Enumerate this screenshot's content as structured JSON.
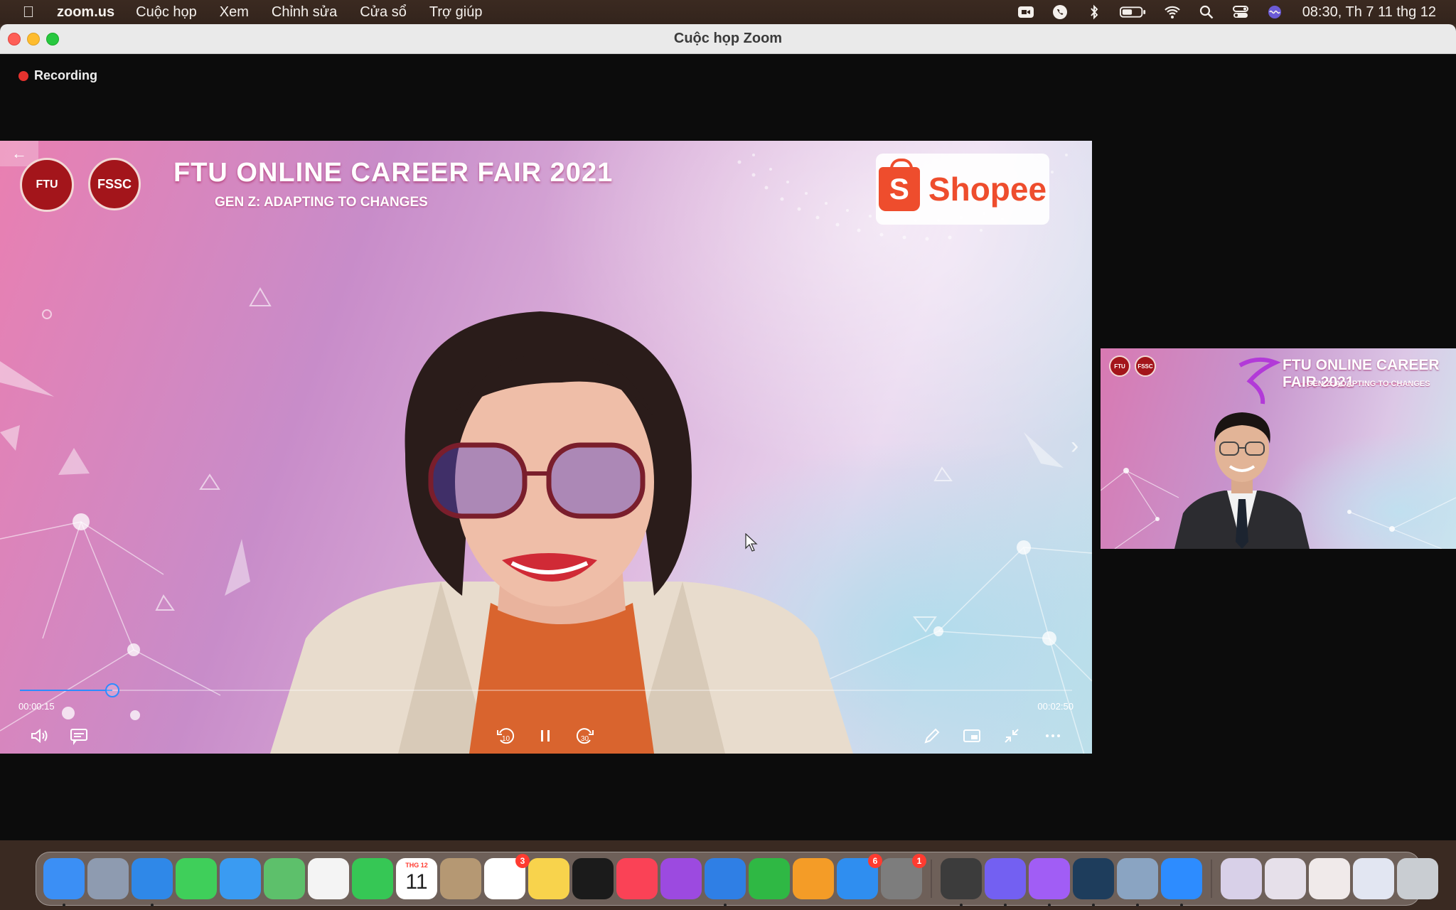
{
  "menubar": {
    "app_name": "zoom.us",
    "menus": [
      "Cuộc họp",
      "Xem",
      "Chỉnh sửa",
      "Cửa sổ",
      "Trợ giúp"
    ],
    "tray_icons": [
      "zoom-tray-icon",
      "viber-tray-icon",
      "bluetooth-icon",
      "battery-icon",
      "wifi-icon",
      "spotlight-search-icon",
      "control-center-icon",
      "siri-icon"
    ],
    "clock": "08:30, Th 7 11 thg 12"
  },
  "window": {
    "title": "Cuộc họp Zoom",
    "recording_label": "Recording"
  },
  "share": {
    "logo_left": "FTU",
    "logo_right": "FSSC",
    "title": "FTU ONLINE CAREER FAIR 2021",
    "subtitle": "GEN Z: ADAPTING TO CHANGES",
    "sponsor_letter": "S",
    "sponsor": "Shopee",
    "player": {
      "time_current": "00:00:15",
      "time_total": "00:02:50",
      "progress_fraction": 0.088,
      "rewind_seconds": "10",
      "forward_seconds": "30"
    }
  },
  "thumbnail": {
    "title": "FTU ONLINE CAREER FAIR 2021",
    "subtitle": "GEN Z: ADAPTING TO CHANGES"
  },
  "dock": {
    "calendar_month": "THG 12",
    "calendar_day": "11",
    "apps": [
      {
        "name": "finder",
        "color": "#3b8ff5",
        "running": true
      },
      {
        "name": "launchpad",
        "color": "#8e9bb0",
        "running": false
      },
      {
        "name": "safari",
        "color": "#2f88e8",
        "running": true
      },
      {
        "name": "messages",
        "color": "#3fcf5a",
        "running": false
      },
      {
        "name": "mail",
        "color": "#3a9bf2",
        "running": false
      },
      {
        "name": "maps",
        "color": "#5dc06b",
        "running": false
      },
      {
        "name": "photos",
        "color": "#f4f4f4",
        "running": false
      },
      {
        "name": "facetime",
        "color": "#36c755",
        "running": false
      },
      {
        "name": "calendar",
        "color": "#ffffff",
        "running": false
      },
      {
        "name": "contacts",
        "color": "#b59873",
        "running": false
      },
      {
        "name": "reminders",
        "color": "#ffffff",
        "running": false,
        "badge": "3"
      },
      {
        "name": "notes",
        "color": "#f8d34c",
        "running": false
      },
      {
        "name": "apple-tv",
        "color": "#1b1b1b",
        "running": false
      },
      {
        "name": "music",
        "color": "#fa4256",
        "running": false
      },
      {
        "name": "podcasts",
        "color": "#9c4ae0",
        "running": false
      },
      {
        "name": "keynote",
        "color": "#2f7fe5",
        "running": true
      },
      {
        "name": "numbers",
        "color": "#2fb844",
        "running": false
      },
      {
        "name": "pages",
        "color": "#f49c27",
        "running": false
      },
      {
        "name": "app-store",
        "color": "#2f8ef0",
        "running": false,
        "badge": "6"
      },
      {
        "name": "system-preferences",
        "color": "#7d7d7d",
        "running": false,
        "badge": "1"
      }
    ],
    "apps_right": [
      {
        "name": "screen-recorder",
        "color": "#3c3c3c",
        "running": true
      },
      {
        "name": "viber",
        "color": "#7360f2",
        "running": true
      },
      {
        "name": "messenger",
        "color": "#a15df5",
        "running": true
      },
      {
        "name": "quicktime",
        "color": "#1e3d5c",
        "running": true
      },
      {
        "name": "preview",
        "color": "#8aa4c2",
        "running": true
      },
      {
        "name": "zoom",
        "color": "#2d8cff",
        "running": true
      }
    ],
    "stack": [
      {
        "name": "downloads-stack-1",
        "color": "#d8d0e8"
      },
      {
        "name": "downloads-stack-2",
        "color": "#e6e0ea"
      },
      {
        "name": "downloads-stack-3",
        "color": "#f0eaea"
      },
      {
        "name": "downloads-stack-4",
        "color": "#e2e6f2"
      },
      {
        "name": "trash",
        "color": "#c9cdd2"
      }
    ]
  }
}
